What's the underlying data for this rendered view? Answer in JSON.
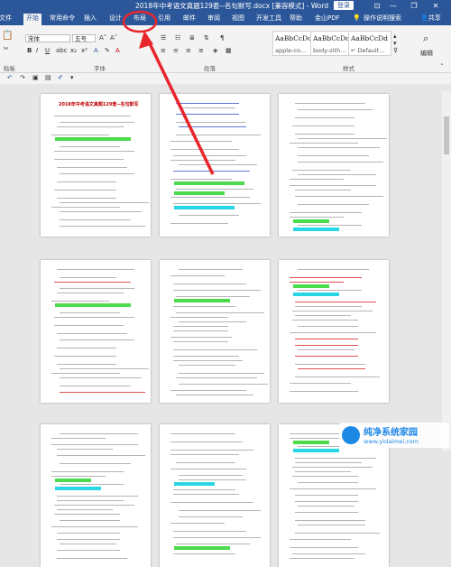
{
  "window": {
    "title": "2018年中考语文真题129套--名句默写.docx [兼容模式] - Word",
    "login_label": "登录",
    "share_label": "共享",
    "minimize": "—",
    "restore": "❐",
    "close": "✕"
  },
  "tabs": [
    "文件",
    "开始",
    "常用命令",
    "插入",
    "设计",
    "布局",
    "引用",
    "邮件",
    "审阅",
    "视图",
    "开发工具",
    "帮助",
    "金山PDF",
    "操作说明搜索"
  ],
  "active_tab": "开始",
  "ribbon": {
    "font_name": "宋体",
    "font_size": "五号",
    "font_group_label": "字体",
    "paragraph_group_label": "段落",
    "styles_group_label": "样式",
    "editing_label": "编辑",
    "clipboard_label": "贴板",
    "styles": [
      {
        "preview": "AaBbCcDc",
        "name": "apple-co..."
      },
      {
        "preview": "AaBbCcDc",
        "name": "body-zith..."
      },
      {
        "preview": "AaBbCcDd",
        "name": "↵ Default..."
      }
    ]
  },
  "document": {
    "page1_title": "2018年中考语文真题129套--名句默写"
  },
  "annotation": {
    "highlight_color": "#e8262c",
    "target_tab": "布局"
  },
  "watermark": {
    "title": "纯净系统家园",
    "url": "www.yidaimei.com"
  },
  "colors": {
    "title_bar": "#2b579a",
    "ribbon_bg": "#f3f3f3",
    "workspace": "#e6e6e6"
  }
}
